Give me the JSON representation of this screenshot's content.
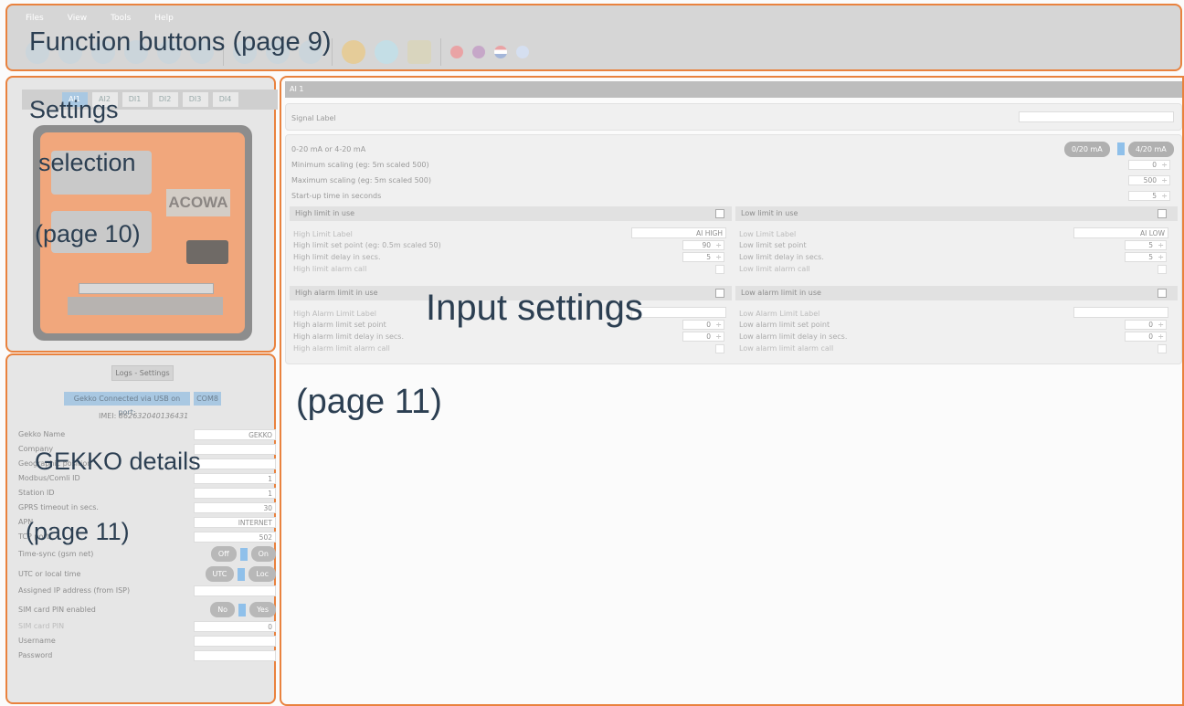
{
  "menu": [
    "Files",
    "View",
    "Tools",
    "Help"
  ],
  "annotations": {
    "function_buttons": "Function buttons (page 9)",
    "settings_selection_1": "Settings",
    "settings_selection_2": "selection",
    "settings_selection_3": "(page 10)",
    "input_settings_1": "Input settings",
    "input_settings_2": "(page 11)",
    "gekko_details_1": "GEKKO details",
    "gekko_details_2": "(page 11)"
  },
  "toolbar_icons": [
    "save-icon",
    "undo-icon",
    "monitor-icon",
    "chart-icon",
    "download-icon",
    "upload-icon",
    "gear-icon",
    "pulse-icon",
    "calibrate-icon"
  ],
  "flags": [
    "flag-dk-icon",
    "flag-uk-icon",
    "flag-nl-icon",
    "flag-fi-icon"
  ],
  "tabs": [
    "AI1",
    "AI2",
    "DI1",
    "DI2",
    "DI3",
    "DI4"
  ],
  "device": {
    "brand": "ACOWA"
  },
  "details": {
    "logs_button": "Logs - Settings",
    "usb_label": "Gekko Connected via USB on port:",
    "port": "COM8",
    "imei_label": "IMEI:",
    "imei_value": "862632040136431",
    "fields": [
      {
        "label": "Gekko Name",
        "value": "GEKKO"
      },
      {
        "label": "Company",
        "value": ""
      },
      {
        "label": "Geographic position",
        "value": ""
      },
      {
        "label": "Modbus/Comli ID",
        "value": "1"
      },
      {
        "label": "Station ID",
        "value": "1"
      },
      {
        "label": "GPRS timeout in secs.",
        "value": "30"
      },
      {
        "label": "APN",
        "value": "INTERNET"
      },
      {
        "label": "TCP port",
        "value": "502"
      }
    ],
    "toggles": [
      {
        "label": "Time-sync (gsm net)",
        "off": "Off",
        "on": "On"
      },
      {
        "label": "UTC or local time",
        "off": "UTC",
        "on": "Loc"
      }
    ],
    "assigned_ip_label": "Assigned IP address (from ISP)",
    "assigned_ip_value": "",
    "sim_toggle": {
      "label": "SIM card PIN enabled",
      "off": "No",
      "on": "Yes"
    },
    "sim_pin_label": "SIM card PIN",
    "sim_pin_value": "0",
    "username_label": "Username",
    "username_value": "",
    "password_label": "Password",
    "password_value": ""
  },
  "input": {
    "title": "AI 1",
    "signal_label": "Signal Label",
    "signal_value": "",
    "range_label": "0-20 mA or 4-20 mA",
    "range_opt1": "0/20 mA",
    "range_opt2": "4/20 mA",
    "min_label": "Minimum scaling (eg: 5m scaled 500)",
    "min_value": "0",
    "max_label": "Maximum scaling (eg: 5m scaled 500)",
    "max_value": "500",
    "startup_label": "Start-up time in seconds",
    "startup_value": "5",
    "high_limit": {
      "header": "High limit in use",
      "label_text": "High Limit Label",
      "label_value": "AI HIGH",
      "setpoint_label": "High limit set point (eg: 0.5m scaled 50)",
      "setpoint_value": "90",
      "delay_label": "High limit delay in secs.",
      "delay_value": "5",
      "alarm_label": "High limit alarm call"
    },
    "low_limit": {
      "header": "Low limit in use",
      "label_text": "Low Limit Label",
      "label_value": "AI LOW",
      "setpoint_label": "Low limit set point",
      "setpoint_value": "5",
      "delay_label": "Low limit delay in secs.",
      "delay_value": "5",
      "alarm_label": "Low limit alarm call"
    },
    "high_alarm": {
      "header": "High alarm limit in use",
      "label_text": "High Alarm Limit Label",
      "label_value": "",
      "setpoint_label": "High alarm limit set point",
      "setpoint_value": "0",
      "delay_label": "High alarm limit delay in secs.",
      "delay_value": "0",
      "alarm_label": "High alarm limit alarm call"
    },
    "low_alarm": {
      "header": "Low alarm limit in use",
      "label_text": "Low Alarm Limit Label",
      "label_value": "",
      "setpoint_label": "Low alarm limit set point",
      "setpoint_value": "0",
      "delay_label": "Low alarm limit delay in secs.",
      "delay_value": "0",
      "alarm_label": "Low alarm limit alarm call"
    }
  }
}
